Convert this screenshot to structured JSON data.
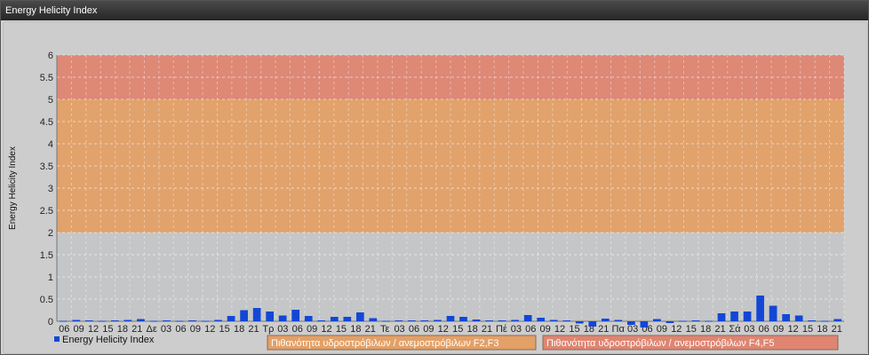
{
  "window": {
    "title": "Energy Helicity Index"
  },
  "chart_data": {
    "type": "bar",
    "ylabel": "Energy Helicity Index",
    "ylim": [
      0,
      6
    ],
    "yticks": [
      "0",
      "0.5",
      "1",
      "1.5",
      "2",
      "2.5",
      "3",
      "3.5",
      "4",
      "4.5",
      "5",
      "5.5",
      "6"
    ],
    "grid": true,
    "legend_position": "bottom-left",
    "categories": [
      "06",
      "09",
      "12",
      "15",
      "18",
      "21",
      "Δε",
      "03",
      "06",
      "09",
      "12",
      "15",
      "18",
      "21",
      "Τρ",
      "03",
      "06",
      "09",
      "12",
      "15",
      "18",
      "21",
      "Τε",
      "03",
      "06",
      "09",
      "12",
      "15",
      "18",
      "21",
      "Πέ",
      "03",
      "06",
      "09",
      "12",
      "15",
      "18",
      "21",
      "Πα",
      "03",
      "06",
      "09",
      "12",
      "15",
      "18",
      "21",
      "Σά",
      "03",
      "06",
      "09",
      "12",
      "15",
      "18",
      "21"
    ],
    "series": [
      {
        "name": "Energy Helicity Index",
        "color": "#1247d6",
        "values": [
          0.01,
          0.03,
          0.02,
          0.01,
          0.02,
          0.03,
          0.05,
          0.01,
          0.02,
          0.01,
          0.02,
          0.01,
          0.03,
          0.12,
          0.25,
          0.3,
          0.22,
          0.13,
          0.26,
          0.12,
          0.02,
          0.1,
          0.1,
          0.2,
          0.07,
          0.01,
          0.02,
          0.02,
          0.02,
          0.03,
          0.12,
          0.1,
          0.04,
          0.02,
          0.02,
          0.03,
          0.14,
          0.08,
          0.03,
          0.02,
          -0.05,
          -0.12,
          0.06,
          0.03,
          -0.08,
          -0.14,
          0.05,
          -0.04,
          0.01,
          0.02,
          0.01,
          0.18,
          0.22,
          0.22,
          0.58,
          0.35,
          0.16,
          0.13,
          0.02,
          0.01,
          0.05
        ]
      }
    ],
    "bands": [
      {
        "from": 2,
        "to": 5,
        "color": "#e3a067",
        "label": "Πιθανότητα υδροστρόβιλων / ανεμοστρόβιλων F2,F3"
      },
      {
        "from": 5,
        "to": 6,
        "color": "#df8572",
        "label": "Πιθανότητα υδροστρόβιλων / ανεμοστρόβιλων F4,F5"
      }
    ]
  }
}
